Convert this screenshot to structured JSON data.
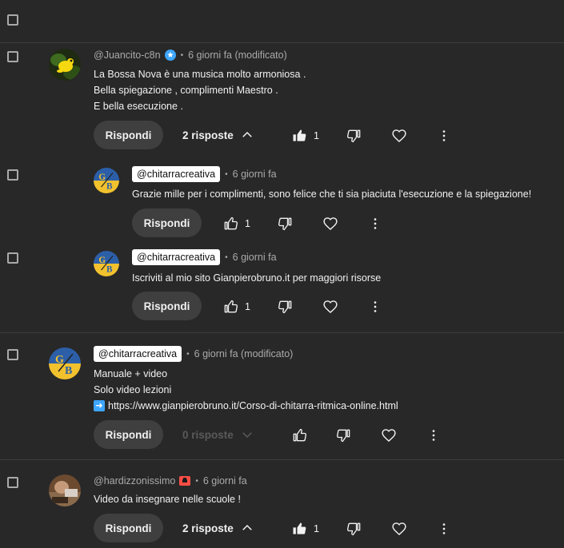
{
  "comments": [
    {
      "handle": "@Juancito-c8n",
      "badge": "verified-star-icon",
      "time": "6 giorni fa (modificato)",
      "lines": [
        "La Bossa Nova è una musica molto armoniosa .",
        "Bella spiegazione , complimenti Maestro .",
        "E bella esecuzione ."
      ],
      "reply_label": "Rispondi",
      "replies_label": "2 risposte",
      "like_count": "1"
    },
    {
      "handle": "@chitarracreativa",
      "time": "6 giorni fa",
      "lines": [
        "Grazie mille per i complimenti, sono felice che ti sia piaciuta l'esecuzione e la spiegazione!"
      ],
      "reply_label": "Rispondi",
      "like_count": "1"
    },
    {
      "handle": "@chitarracreativa",
      "time": "6 giorni fa",
      "lines": [
        "Iscriviti al mio sito Gianpierobruno.it  per maggiori risorse"
      ],
      "reply_label": "Rispondi",
      "like_count": "1"
    },
    {
      "handle": "@chitarracreativa",
      "time": "6 giorni fa (modificato)",
      "lines": [
        "Manuale + video",
        "Solo video lezioni"
      ],
      "link_icon": "right-arrow-emoji",
      "link_text": "https://www.gianpierobruno.it/Corso-di-chitarra-ritmica-online.html",
      "reply_label": "Rispondi",
      "replies_label": "0 risposte"
    },
    {
      "handle": "@hardizzonissimo",
      "badge": "red-member-badge-icon",
      "time": "6 giorni fa",
      "lines": [
        "Video da insegnare nelle scuole !"
      ],
      "reply_label": "Rispondi",
      "replies_label": "2 risposte",
      "like_count": "1"
    }
  ],
  "colors": {
    "background": "#282828",
    "pill": "#3f3f3f",
    "text": "#f1f1f1",
    "muted": "#aaaaaa",
    "link": "#3ea6ff"
  }
}
